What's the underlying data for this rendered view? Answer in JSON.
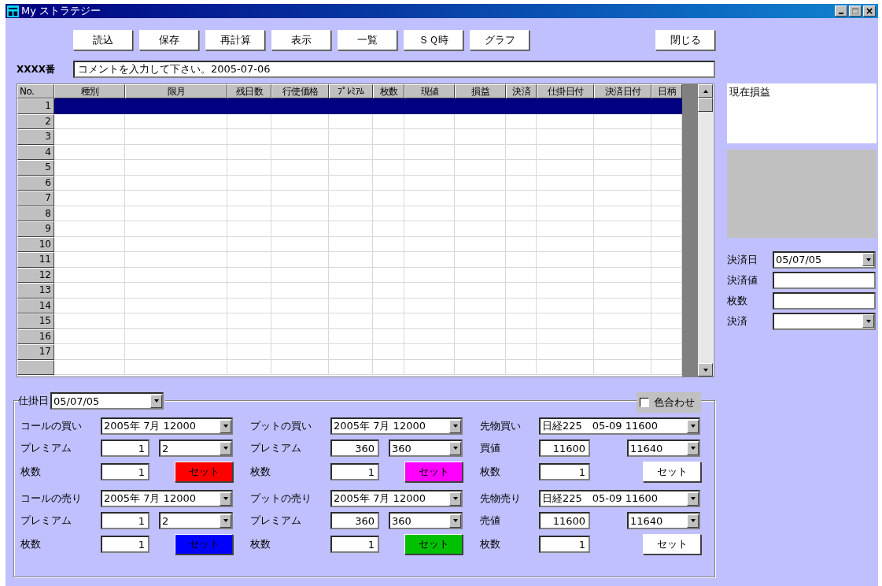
{
  "window": {
    "title": "My ストラテジー"
  },
  "toolbar": {
    "buttons": [
      {
        "label": "読込"
      },
      {
        "label": "保存"
      },
      {
        "label": "再計算"
      },
      {
        "label": "表示"
      },
      {
        "label": "一覧"
      },
      {
        "label": "ＳＱ時"
      },
      {
        "label": "グラフ"
      }
    ],
    "close_button": "閉じる"
  },
  "comment": {
    "label": "XXXX番",
    "value": "コメントを入力して下さい。2005-07-06"
  },
  "grid": {
    "columns": [
      "No.",
      "種別",
      "限月",
      "残日数",
      "行使価格",
      "ﾌﾟﾚﾐｱﾑ",
      "枚数",
      "現値",
      "損益",
      "決済",
      "仕掛日付",
      "決済日付",
      "日柄"
    ],
    "rows": [
      {
        "no": "1",
        "selected": true
      },
      {
        "no": "2",
        "selected": false
      },
      {
        "no": "3",
        "selected": false
      },
      {
        "no": "4",
        "selected": false
      },
      {
        "no": "5",
        "selected": false
      },
      {
        "no": "6",
        "selected": false
      },
      {
        "no": "7",
        "selected": false
      },
      {
        "no": "8",
        "selected": false
      },
      {
        "no": "9",
        "selected": false
      },
      {
        "no": "10",
        "selected": false
      },
      {
        "no": "11",
        "selected": false
      },
      {
        "no": "12",
        "selected": false
      },
      {
        "no": "13",
        "selected": false
      },
      {
        "no": "14",
        "selected": false
      },
      {
        "no": "15",
        "selected": false
      },
      {
        "no": "16",
        "selected": false
      },
      {
        "no": "17",
        "selected": false
      }
    ]
  },
  "side_panel": {
    "title": "現在損益",
    "fields": [
      {
        "kind": "select",
        "label": "決済日",
        "value": "05/07/05"
      },
      {
        "kind": "input",
        "label": "決済値"
      },
      {
        "kind": "input",
        "label": "枚数"
      },
      {
        "kind": "select",
        "label": "決済"
      }
    ]
  },
  "entry": {
    "label": "仕掛日",
    "date": "05/07/05",
    "color_match": {
      "label": "色合わせ",
      "checked": false
    },
    "columns": [
      [
        {
          "kind": "option",
          "label": "コールの買い",
          "contract": "2005年 7月 12000",
          "price_label": "プレミアム",
          "price": "1",
          "price_choice": "2",
          "qty_label": "枚数",
          "qty": "1",
          "set_button": {
            "label": "セット",
            "color": "#ff0000"
          }
        },
        {
          "kind": "option",
          "label": "コールの売り",
          "contract": "2005年 7月 12000",
          "price_label": "プレミアム",
          "price": "1",
          "price_choice": "2",
          "qty_label": "枚数",
          "qty": "1",
          "set_button": {
            "label": "セット",
            "color": "#0000ff"
          }
        }
      ],
      [
        {
          "kind": "option",
          "label": "プットの買い",
          "contract": "2005年 7月 12000",
          "price_label": "プレミアム",
          "price": "360",
          "price_choice": "360",
          "qty_label": "枚数",
          "qty": "1",
          "set_button": {
            "label": "セット",
            "color": "#ff00ff"
          }
        },
        {
          "kind": "option",
          "label": "プットの売り",
          "contract": "2005年 7月 12000",
          "price_label": "プレミアム",
          "price": "360",
          "price_choice": "360",
          "qty_label": "枚数",
          "qty": "1",
          "set_button": {
            "label": "セット",
            "color": "#00c000"
          }
        }
      ],
      [
        {
          "kind": "future",
          "label": "先物買い",
          "contract": "日経225　05-09 11600",
          "price_label": "買値",
          "price": "11600",
          "price_choice": "11640",
          "qty_label": "枚数",
          "qty": "1",
          "set_button": {
            "label": "セット",
            "color": "#ffffff"
          }
        },
        {
          "kind": "future",
          "label": "先物売り",
          "contract": "日経225　05-09 11600",
          "price_label": "売値",
          "price": "11600",
          "price_choice": "11640",
          "qty_label": "枚数",
          "qty": "1",
          "set_button": {
            "label": "セット",
            "color": "#ffffff"
          }
        }
      ]
    ]
  }
}
